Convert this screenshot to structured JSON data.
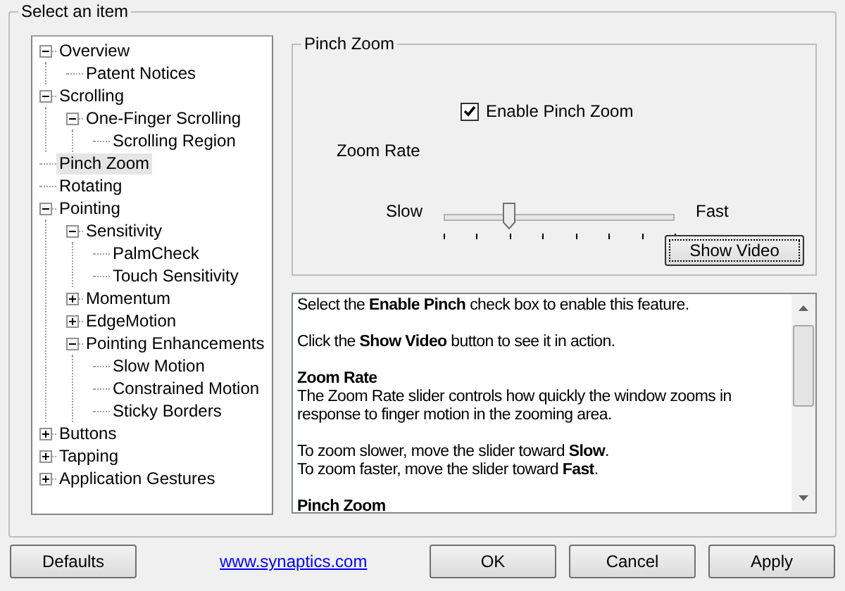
{
  "group_title": "Select an item",
  "tree": [
    {
      "label": "Overview",
      "selected": false,
      "expanded": true,
      "children": [
        {
          "label": "Patent Notices",
          "selected": false
        }
      ]
    },
    {
      "label": "Scrolling",
      "selected": false,
      "expanded": true,
      "children": [
        {
          "label": "One-Finger Scrolling",
          "selected": false,
          "expanded": true,
          "children": [
            {
              "label": "Scrolling Region",
              "selected": false
            }
          ]
        }
      ]
    },
    {
      "label": "Pinch Zoom",
      "selected": true
    },
    {
      "label": "Rotating",
      "selected": false
    },
    {
      "label": "Pointing",
      "selected": false,
      "expanded": true,
      "children": [
        {
          "label": "Sensitivity",
          "selected": false,
          "expanded": true,
          "children": [
            {
              "label": "PalmCheck",
              "selected": false
            },
            {
              "label": "Touch Sensitivity",
              "selected": false
            }
          ]
        },
        {
          "label": "Momentum",
          "selected": false,
          "expanded": false
        },
        {
          "label": "EdgeMotion",
          "selected": false,
          "expanded": false
        },
        {
          "label": "Pointing Enhancements",
          "selected": false,
          "expanded": true,
          "children": [
            {
              "label": "Slow Motion",
              "selected": false
            },
            {
              "label": "Constrained Motion",
              "selected": false
            },
            {
              "label": "Sticky Borders",
              "selected": false
            }
          ]
        }
      ]
    },
    {
      "label": "Buttons",
      "selected": false,
      "expanded": false
    },
    {
      "label": "Tapping",
      "selected": false,
      "expanded": false
    },
    {
      "label": "Application Gestures",
      "selected": false,
      "expanded": false
    }
  ],
  "settings": {
    "title": "Pinch Zoom",
    "checkbox": {
      "label": "Enable Pinch Zoom",
      "checked": true
    },
    "slider_label": "Zoom Rate",
    "slider": {
      "min_label": "Slow",
      "max_label": "Fast",
      "level": 0.2857
    },
    "video_button": "Show Video"
  },
  "help": [
    {
      "kind": "text",
      "text": "Select the **Enable Pinch** check box to enable this feature."
    },
    {
      "kind": "text",
      "text": "Click the **Show Video** button to see it in action."
    },
    {
      "kind": "heading",
      "text": "Zoom Rate"
    },
    {
      "kind": "text",
      "text": "The Zoom Rate slider controls how quickly the window zooms in response to finger motion in the zooming area."
    },
    {
      "kind": "text",
      "text": "To zoom slower, move the slider toward **Slow**.\nTo zoom faster, move the slider toward **Fast**."
    },
    {
      "kind": "heading",
      "text": "Pinch Zoom"
    }
  ],
  "footer": {
    "defaults": "Defaults",
    "link": "www.synaptics.com",
    "buttons": [
      "OK",
      "Cancel",
      "Apply"
    ]
  }
}
